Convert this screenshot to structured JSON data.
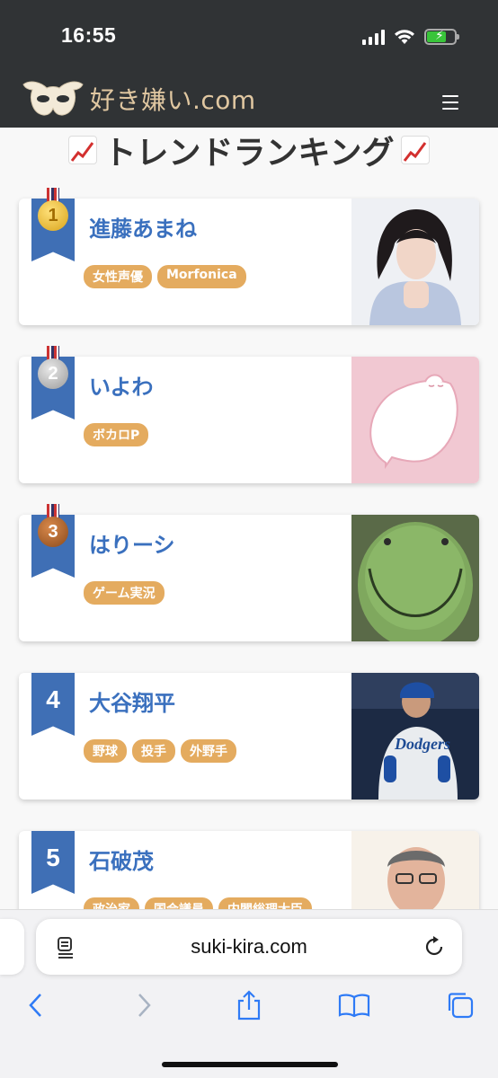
{
  "status_bar": {
    "time": "16:55"
  },
  "site": {
    "logo_text": "好き嫌い.com"
  },
  "page": {
    "title": "トレンドランキング"
  },
  "ranking": [
    {
      "rank": "1",
      "medal": "gold",
      "name": "進藤あまね",
      "tags": [
        "女性声優",
        "Morfonica"
      ]
    },
    {
      "rank": "2",
      "medal": "silver",
      "name": "いよわ",
      "tags": [
        "ボカロP"
      ]
    },
    {
      "rank": "3",
      "medal": "bronze",
      "name": "はりーシ",
      "tags": [
        "ゲーム実況"
      ]
    },
    {
      "rank": "4",
      "medal": null,
      "name": "大谷翔平",
      "tags": [
        "野球",
        "投手",
        "外野手"
      ]
    },
    {
      "rank": "5",
      "medal": null,
      "name": "石破茂",
      "tags": [
        "政治家",
        "国会議員",
        "内閣総理大臣"
      ]
    }
  ],
  "browser": {
    "url": "suki-kira.com"
  },
  "colors": {
    "accent_blue": "#3a70be",
    "ribbon_blue": "#3f6fb5",
    "tag_orange": "#e4ab5f",
    "header_dark": "#303335"
  },
  "icons": [
    "signal-icon",
    "wifi-icon",
    "battery-charging-icon",
    "mask-logo-icon",
    "hamburger-menu-icon",
    "chart-increasing-icon",
    "reader-icon",
    "reload-icon",
    "back-icon",
    "forward-icon",
    "share-icon",
    "bookmarks-icon",
    "tabs-icon"
  ]
}
